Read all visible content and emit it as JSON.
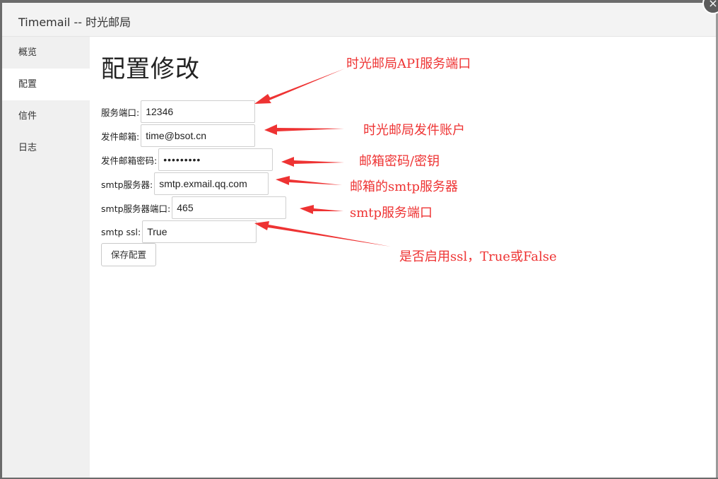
{
  "window": {
    "title": "Timemail -- 时光邮局",
    "close_icon": "close-icon"
  },
  "sidebar": {
    "items": [
      {
        "label": "概览",
        "active": false
      },
      {
        "label": "配置",
        "active": true
      },
      {
        "label": "信件",
        "active": false
      },
      {
        "label": "日志",
        "active": false
      }
    ]
  },
  "main": {
    "page_title": "配置修改",
    "fields": [
      {
        "label": "服务端口:",
        "value": "12346",
        "type": "text"
      },
      {
        "label": "发件邮箱:",
        "value": "time@bsot.cn",
        "type": "text"
      },
      {
        "label": "发件邮箱密码:",
        "value": "•••••••••",
        "type": "password"
      },
      {
        "label": "smtp服务器:",
        "value": "smtp.exmail.qq.com",
        "type": "text"
      },
      {
        "label": "smtp服务器端口:",
        "value": "465",
        "type": "text"
      },
      {
        "label": "smtp ssl:",
        "value": "True",
        "type": "text"
      }
    ],
    "save_label": "保存配置"
  },
  "annotations": {
    "color": "#ee3333",
    "items": [
      "时光邮局API服务端口",
      "时光邮局发件账户",
      "邮箱密码/密钥",
      "邮箱的smtp服务器",
      "smtp服务端口",
      "是否启用ssl，True或False"
    ]
  }
}
